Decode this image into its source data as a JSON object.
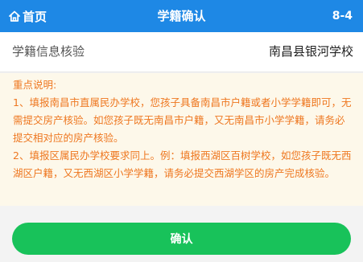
{
  "header": {
    "home_label": "首页",
    "title": "学籍确认",
    "step": "8-4",
    "home_icon": "home-icon"
  },
  "info_row": {
    "label": "学籍信息核验",
    "value": "南昌县银河学校"
  },
  "notice": {
    "heading": "重点说明:",
    "item1": "1、填报南昌市直属民办学校，您孩子具备南昌市户籍或者小学学籍即可，无需提交房产核验。如您孩子既无南昌市户籍，又无南昌市小学学籍，请务必提交相对应的房产核验。",
    "item2": "2、填报区属民办学校要求同上。例：填报西湖区百树学校，如您孩子既无西湖区户籍，又无西湖区小学学籍，请务必提交西湖学区的房产完成核验。"
  },
  "confirm_label": "确认",
  "colors": {
    "header_bg": "#1e88e5",
    "notice_text": "#ee7720",
    "notice_bg": "#fdf8ea",
    "button_bg": "#18c25a"
  }
}
